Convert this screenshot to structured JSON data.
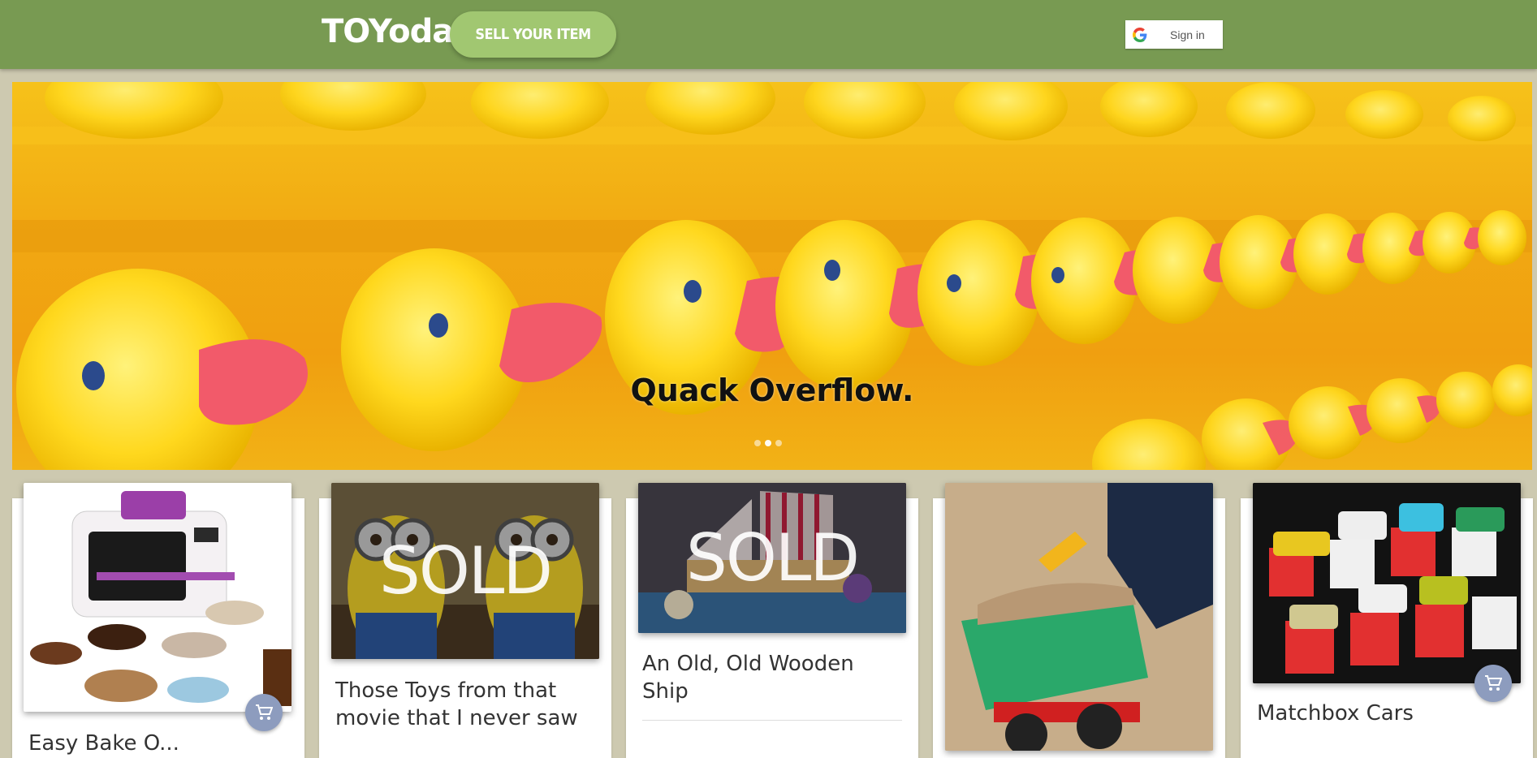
{
  "header": {
    "logo": "TOYoda",
    "sell_label": "SELL YOUR ITEM",
    "signin_label": "Sign in"
  },
  "hero": {
    "caption": "Quack Overflow.",
    "slide_count": 3,
    "active_slide": 2
  },
  "cards": [
    {
      "title": "Easy Bake O...",
      "sold": false,
      "sold_label": ""
    },
    {
      "title": "Those Toys from that movie that I never saw",
      "sold": true,
      "sold_label": "SOLD"
    },
    {
      "title": "An Old, Old Wooden Ship",
      "sold": true,
      "sold_label": "SOLD"
    },
    {
      "title": "",
      "sold": false,
      "sold_label": ""
    },
    {
      "title": "Matchbox Cars",
      "sold": false,
      "sold_label": ""
    }
  ],
  "colors": {
    "header": "#789a52",
    "sell_button": "#a1c771",
    "background": "#cdc9b0",
    "cart_button": "#8d9cbe"
  }
}
